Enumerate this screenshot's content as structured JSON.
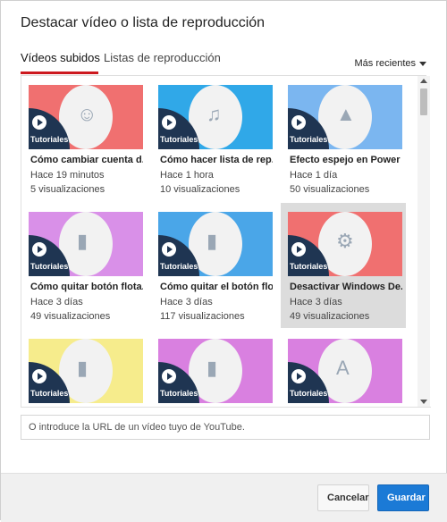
{
  "dialog": {
    "title": "Destacar vídeo o lista de reproducción",
    "tabs": [
      {
        "label": "Vídeos subidos",
        "active": true
      },
      {
        "label": "Listas de reproducción",
        "active": false
      }
    ],
    "sort_label": "Más recientes",
    "url_placeholder": "O introduce la URL de un vídeo tuyo de YouTube.",
    "buttons": {
      "cancel": "Cancelar",
      "save": "Guardar"
    },
    "colors": {
      "accent": "#cc181e",
      "primary_button": "#1b7ad6",
      "badge": "#1f3552"
    }
  },
  "videos": [
    {
      "title": "Cómo cambiar cuenta d...",
      "time": "Hace 19 minutos",
      "views": "5 visualizaciones",
      "thumb_color": "#f07070",
      "icon": "person-icon",
      "badge": "Tutoriales"
    },
    {
      "title": "Cómo hacer lista de rep...",
      "time": "Hace 1 hora",
      "views": "10 visualizaciones",
      "thumb_color": "#30a8e8",
      "icon": "music-list-icon",
      "badge": "Tutoriales"
    },
    {
      "title": "Efecto espejo en Power ...",
      "time": "Hace 1 día",
      "views": "50 visualizaciones",
      "thumb_color": "#7bb6f0",
      "icon": "mirror-image-icon",
      "badge": "Tutoriales"
    },
    {
      "title": "Cómo quitar botón flota...",
      "time": "Hace 3 días",
      "views": "49 visualizaciones",
      "thumb_color": "#d990e8",
      "icon": "phone-icon",
      "badge": "Tutoriales"
    },
    {
      "title": "Cómo quitar el botón flo...",
      "time": "Hace 3 días",
      "views": "117 visualizaciones",
      "thumb_color": "#4aa6e8",
      "icon": "phone-icon",
      "badge": "Tutoriales"
    },
    {
      "title": "Desactivar Windows De...",
      "time": "Hace 3 días",
      "views": "49 visualizaciones",
      "thumb_color": "#f07070",
      "icon": "shield-gear-icon",
      "badge": "Tutoriales",
      "selected": true
    },
    {
      "title": "",
      "time": "",
      "views": "",
      "thumb_color": "#f6ec8c",
      "icon": "phone-icon",
      "badge": "Tutoriales"
    },
    {
      "title": "",
      "time": "",
      "views": "",
      "thumb_color": "#d980e0",
      "icon": "phone-icon",
      "badge": "Tutoriales"
    },
    {
      "title": "",
      "time": "",
      "views": "",
      "thumb_color": "#d980e0",
      "icon": "font-icon",
      "badge": "Tutoriales"
    }
  ]
}
